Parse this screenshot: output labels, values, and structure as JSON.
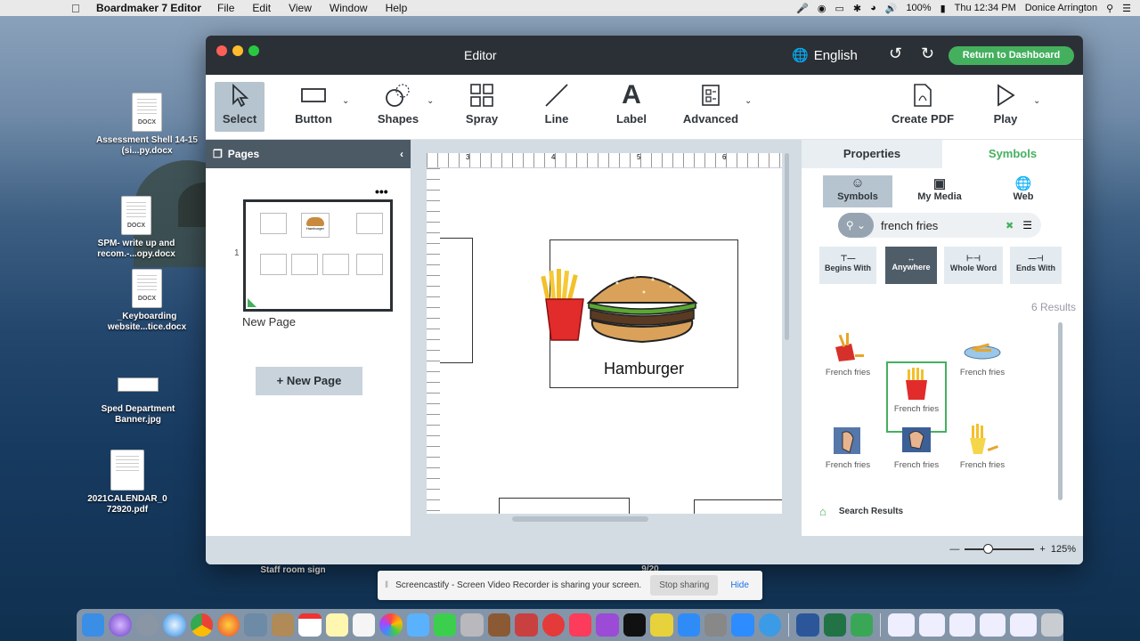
{
  "menubar": {
    "app": "Boardmaker 7 Editor",
    "items": [
      "File",
      "Edit",
      "View",
      "Window",
      "Help"
    ],
    "battery": "100%",
    "clock": "Thu 12:34 PM",
    "user": "Donice Arrington"
  },
  "desktop": {
    "icons": [
      {
        "label": "Assessment Shell 14-15 (si...py.docx",
        "tag": "DOCX"
      },
      {
        "label": "SPM- write up and recom.-...opy.docx",
        "tag": "DOCX"
      },
      {
        "label": "_Keyboarding website...tice.docx",
        "tag": "DOCX"
      },
      {
        "label": "Sped Department Banner.jpg",
        "tag": ""
      },
      {
        "label": "2021CALENDAR_0 72920.pdf",
        "tag": ""
      }
    ],
    "staff_label": "Staff room sign",
    "date_label": "9/20"
  },
  "window": {
    "title": "Editor",
    "language": "English",
    "dashboard_button": "Return to Dashboard"
  },
  "toolbar": {
    "select": "Select",
    "button": "Button",
    "shapes": "Shapes",
    "spray": "Spray",
    "line": "Line",
    "label": "Label",
    "label_glyph": "A",
    "advanced": "Advanced",
    "create_pdf": "Create PDF",
    "play": "Play"
  },
  "pages": {
    "header": "Pages",
    "page_number": "1",
    "page_name": "New Page",
    "new_page": "New Page",
    "thumb_caption": "Hamburger"
  },
  "canvas": {
    "symbol_label": "Hamburger",
    "ruler": [
      "3",
      "4",
      "5",
      "6"
    ]
  },
  "panel": {
    "tab_properties": "Properties",
    "tab_symbols": "Symbols",
    "sources": [
      "Symbols",
      "My Media",
      "Web"
    ],
    "search_value": "french fries",
    "match_modes": [
      "Begins With",
      "Anywhere",
      "Whole Word",
      "Ends With"
    ],
    "results_count": "6 Results",
    "results": [
      "French fries",
      "French fries",
      "French fries",
      "French fries",
      "French fries",
      "French fries"
    ],
    "breadcrumb": "Search Results"
  },
  "zoom": {
    "level": "125%",
    "fraction": 0.33
  },
  "share": {
    "message": "Screencastify - Screen Video Recorder is sharing your screen.",
    "stop": "Stop sharing",
    "hide": "Hide"
  },
  "colors": {
    "accent": "#44b05e",
    "titlebar": "#2b3036",
    "panel_header": "#4c5a66"
  }
}
